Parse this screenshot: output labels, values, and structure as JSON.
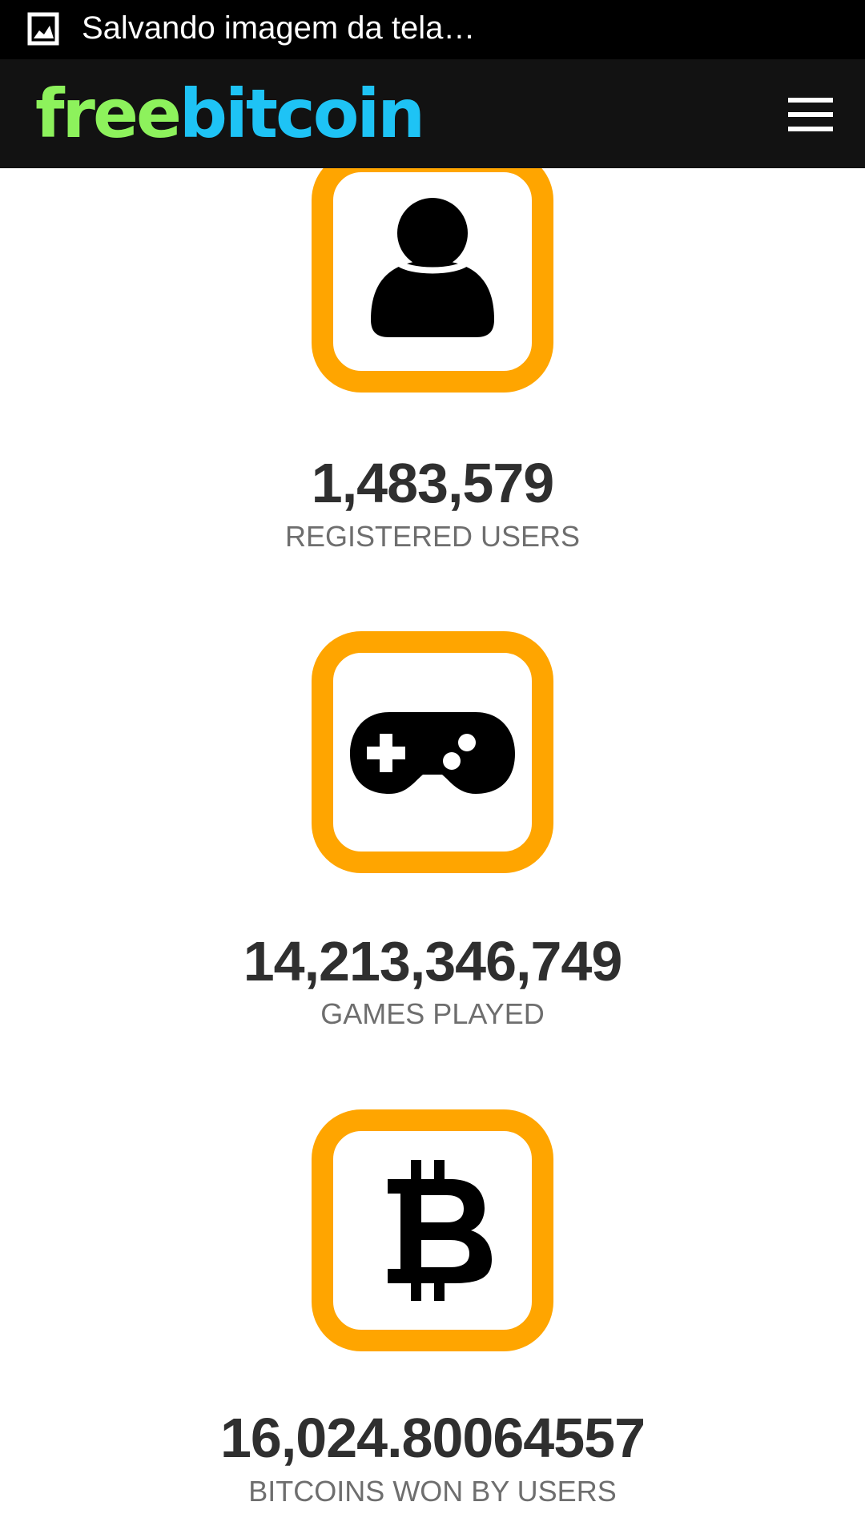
{
  "status_bar": {
    "icon": "image-icon",
    "text": "Salvando imagem da tela…"
  },
  "header": {
    "logo_part1": "free",
    "logo_part2": "bitcoin",
    "menu_icon": "hamburger-menu-icon"
  },
  "colors": {
    "accent_orange": "#ffa500",
    "logo_green": "#8df25c",
    "logo_blue": "#1ec3f5",
    "header_bg": "#121212"
  },
  "stats": [
    {
      "icon": "user-icon",
      "value": "1,483,579",
      "label": "REGISTERED USERS"
    },
    {
      "icon": "gamepad-icon",
      "value": "14,213,346,749",
      "label": "GAMES PLAYED"
    },
    {
      "icon": "bitcoin-icon",
      "value": "16,024.80064557",
      "label": "BITCOINS WON BY USERS"
    }
  ]
}
